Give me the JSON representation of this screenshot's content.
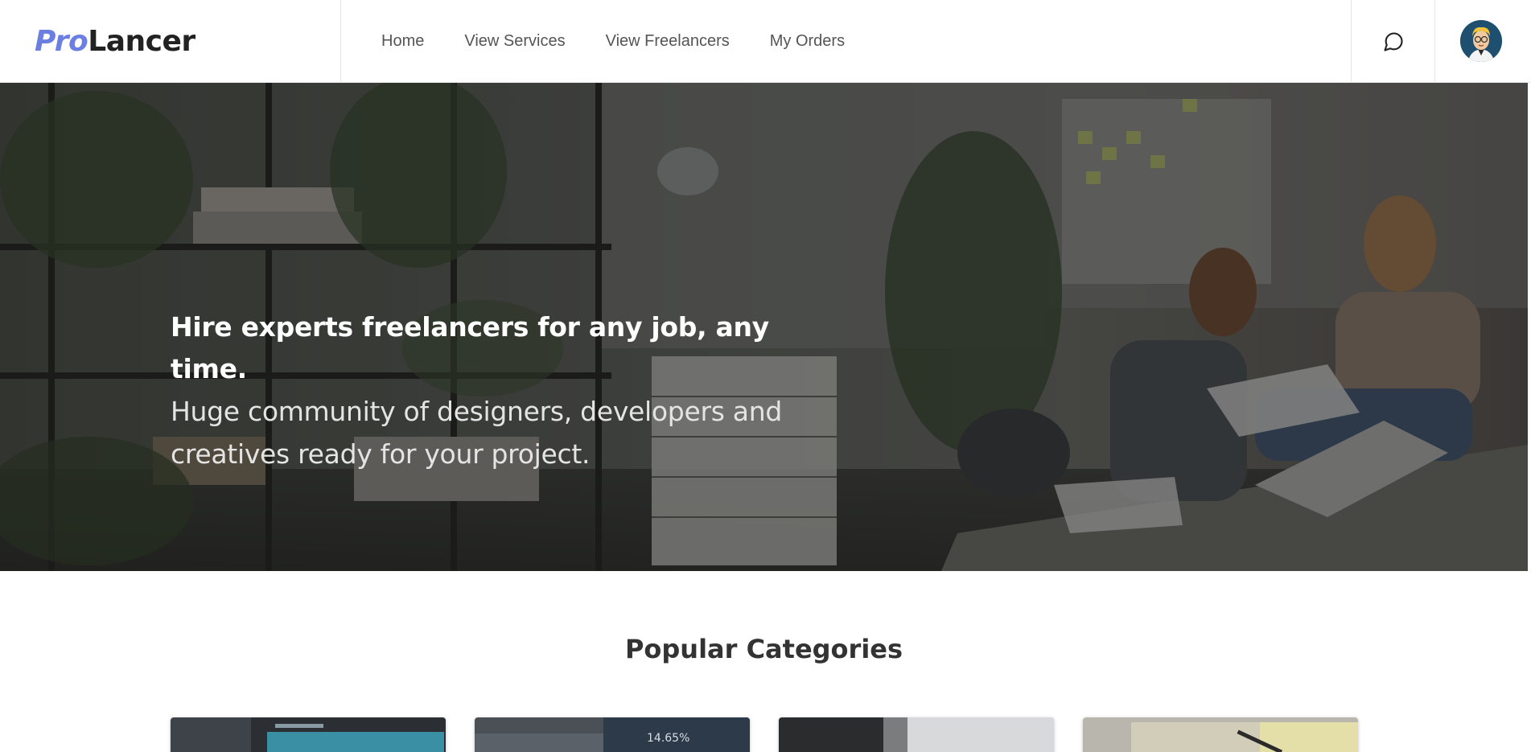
{
  "brand": {
    "pro": "Pro",
    "lancer": "Lancer"
  },
  "nav": {
    "links": [
      "Home",
      "View Services",
      "View Freelancers",
      "My Orders"
    ]
  },
  "icons": {
    "chat": "chat-bubble-icon",
    "avatar": "user-avatar-cartoon"
  },
  "hero": {
    "title": "Hire experts freelancers for any job, any time.",
    "subtitle": "Huge community of designers, developers and creatives ready for your project."
  },
  "categories": {
    "title": "Popular Categories",
    "card_texts": [
      "14.65%"
    ]
  },
  "colors": {
    "brand_accent": "#6b7fe3",
    "nav_text": "#555555"
  }
}
